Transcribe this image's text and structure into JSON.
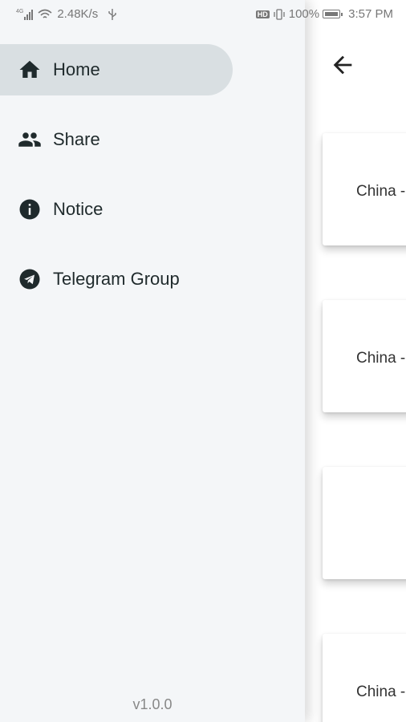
{
  "status_bar": {
    "network_speed": "2.48K/s",
    "battery": "100%",
    "time": "3:57 PM",
    "hd_badge": "HD",
    "signal_tag": "4G"
  },
  "drawer": {
    "items": [
      {
        "label": "Home",
        "icon": "home-icon",
        "active": true
      },
      {
        "label": "Share",
        "icon": "people-icon",
        "active": false
      },
      {
        "label": "Notice",
        "icon": "info-icon",
        "active": false
      },
      {
        "label": "Telegram Group",
        "icon": "telegram-icon",
        "active": false
      }
    ],
    "version": "v1.0.0"
  },
  "content": {
    "cards": [
      {
        "label": "China -"
      },
      {
        "label": "China -"
      },
      {
        "label": ""
      },
      {
        "label": "China -"
      }
    ]
  },
  "colors": {
    "drawer_bg": "#f4f6f8",
    "active_item_bg": "#d9dfe2",
    "icon_color": "#1f2a2c"
  }
}
